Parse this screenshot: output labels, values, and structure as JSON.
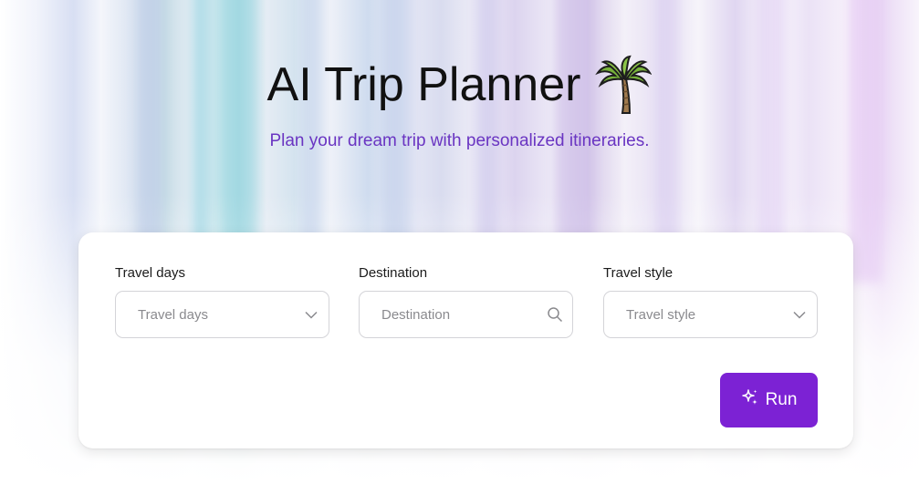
{
  "header": {
    "title": "AI Trip Planner",
    "subtitle": "Plan your dream trip with personalized itineraries.",
    "title_icon": "palm-tree-icon"
  },
  "form": {
    "travel_days": {
      "label": "Travel days",
      "placeholder": "Travel days",
      "icon": "chevron-down-icon"
    },
    "destination": {
      "label": "Destination",
      "placeholder": "Destination",
      "icon": "search-icon"
    },
    "travel_style": {
      "label": "Travel style",
      "placeholder": "Travel style",
      "icon": "chevron-down-icon"
    },
    "run_button": {
      "label": "Run",
      "icon": "sparkle-icon"
    }
  },
  "colors": {
    "accent": "#7c22d4",
    "subtitle": "#6a35c2",
    "title": "#111111"
  }
}
